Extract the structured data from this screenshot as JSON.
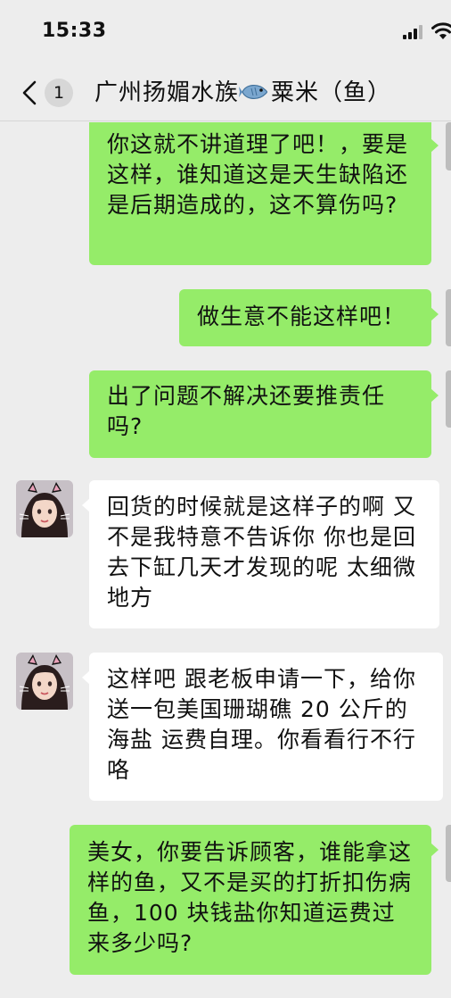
{
  "status": {
    "time": "15:33",
    "icons": [
      "signal-icon",
      "wifi-icon"
    ]
  },
  "nav": {
    "back_icon": "chevron-left-icon",
    "unread_count": "1",
    "title_before": "广州扬媚水族",
    "title_emoji": "fish-icon",
    "title_after": "粟米（鱼）"
  },
  "colors": {
    "outgoing_bubble": "#95ec69",
    "incoming_bubble": "#ffffff",
    "background": "#ededed"
  },
  "messages": [
    {
      "from": "me",
      "text": "你这就不讲道理了吧！，要是这样，谁知道这是天生缺陷还是后期造成的，这不算伤吗?"
    },
    {
      "from": "me",
      "text": "做生意不能这样吧！"
    },
    {
      "from": "me",
      "text": "出了问题不解决还要推责任吗?"
    },
    {
      "from": "other",
      "text": "回货的时候就是这样子的啊 又不是我特意不告诉你 你也是回去下缸几天才发现的呢 太细微地方"
    },
    {
      "from": "other",
      "text": "这样吧 跟老板申请一下，给你送一包美国珊瑚礁 20 公斤的海盐 运费自理。你看看行不行咯"
    },
    {
      "from": "me",
      "text": "美女，你要告诉顾客，谁能拿这样的鱼，又不是买的打折扣伤病鱼，100 块钱盐你知道运费过来多少吗?"
    }
  ]
}
